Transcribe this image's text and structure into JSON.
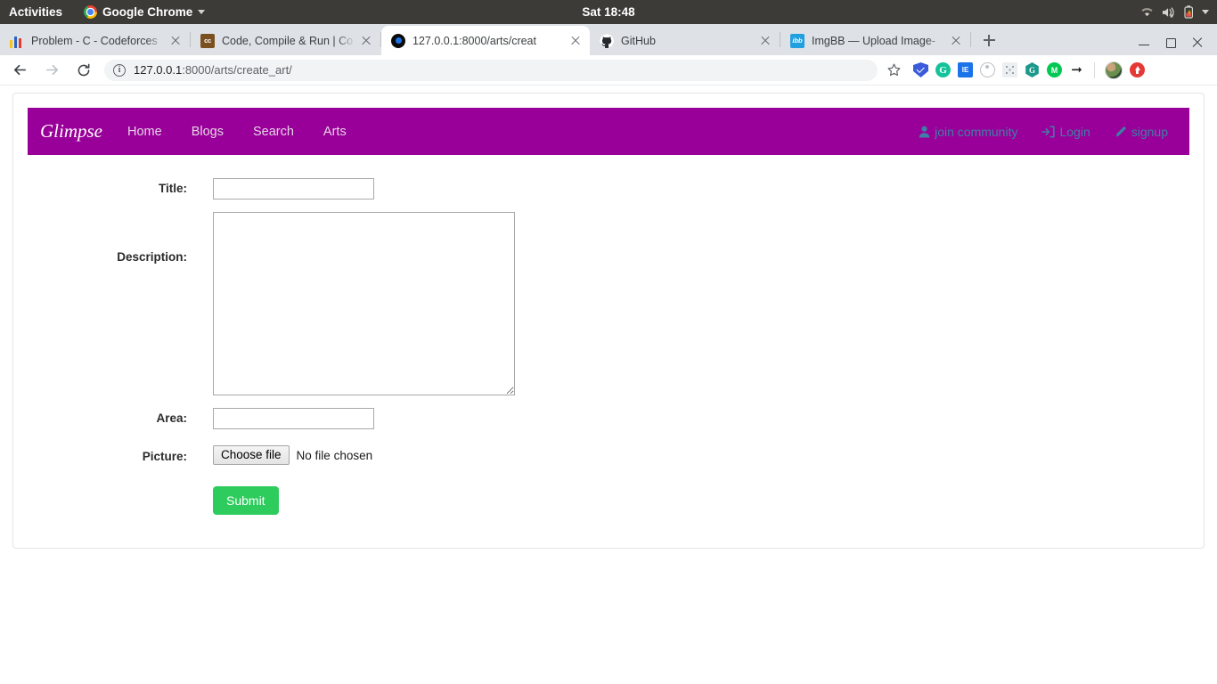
{
  "desktop": {
    "activities": "Activities",
    "app_menu": "Google Chrome",
    "clock": "Sat 18:48",
    "tray_icons": [
      "wifi-icon",
      "volume-muted-icon",
      "battery-charging-icon",
      "caret-down-icon"
    ]
  },
  "browser": {
    "tabs": [
      {
        "title": "Problem - C - Codeforces",
        "favicon": "codeforces-icon",
        "active": false
      },
      {
        "title": "Code, Compile & Run | Co",
        "favicon": "codechef-icon",
        "active": false
      },
      {
        "title": "127.0.0.1:8000/arts/creat",
        "favicon": "django-dot-icon",
        "active": true
      },
      {
        "title": "GitHub",
        "favicon": "github-icon",
        "active": false
      },
      {
        "title": "ImgBB — Upload Image-",
        "favicon": "imgbb-icon",
        "active": false
      }
    ],
    "new_tab_label": "+",
    "window_controls": [
      "minimize",
      "maximize",
      "close"
    ],
    "nav": {
      "back": "back-arrow",
      "forward": "forward-arrow",
      "reload": "reload-icon"
    },
    "omnibox": {
      "site_info_icon": "info-circle-icon",
      "url_host": "127.0.0.1",
      "url_path": ":8000/arts/create_art/",
      "bookmark_icon": "star-icon"
    },
    "extensions": [
      "shield-icon",
      "grammarly-icon",
      "blue-square-icon",
      "ring-icon",
      "dots-grid-icon",
      "hexagon-icon",
      "green-m-icon",
      "arrow-right-icon",
      "profile-avatar",
      "red-upload-icon"
    ]
  },
  "site": {
    "brand": "Glimpse",
    "nav_links": [
      {
        "label": "Home"
      },
      {
        "label": "Blogs"
      },
      {
        "label": "Search"
      },
      {
        "label": "Arts"
      }
    ],
    "auth_links": [
      {
        "label": "join community",
        "icon": "user-icon"
      },
      {
        "label": "Login",
        "icon": "sign-in-icon"
      },
      {
        "label": "signup",
        "icon": "pencil-icon"
      }
    ],
    "colors": {
      "navbar_bg": "#990099",
      "nav_link": "#e6d3e6",
      "auth_link": "#3f7fa6",
      "submit_bg": "#2ecc5d"
    }
  },
  "form": {
    "fields": [
      {
        "label": "Title:",
        "value": "",
        "placeholder": ""
      },
      {
        "label": "Description:",
        "value": "",
        "placeholder": ""
      },
      {
        "label": "Area:",
        "value": "",
        "placeholder": ""
      },
      {
        "label": "Picture:",
        "button": "Choose file",
        "status": "No file chosen"
      }
    ],
    "submit_label": "Submit"
  }
}
